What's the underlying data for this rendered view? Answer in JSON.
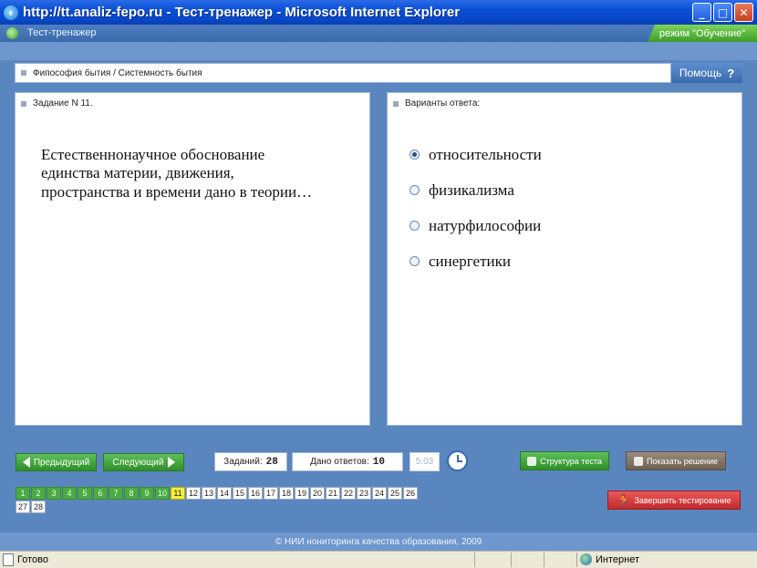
{
  "window": {
    "title": "http://tt.analiz-fepo.ru - Тест-тренажер - Microsoft Internet Explorer",
    "minimize_glyph": "_",
    "maximize_glyph": "□",
    "close_glyph": "✕"
  },
  "app": {
    "title": "Тест-тренажер",
    "mode": "режим \"Обучение\""
  },
  "breadcrumb": "Фипософия бытия / Системность бытия",
  "help": {
    "label": "Помощь",
    "glyph": "?"
  },
  "task": {
    "header": "Задание N 11.",
    "question": "Естественнонаучное обоснование единства материи, движения, пространства и времени дано в теории…"
  },
  "answers": {
    "header": "Варианты ответа:",
    "options": [
      {
        "label": "относительности",
        "checked": true
      },
      {
        "label": "физикализма",
        "checked": false
      },
      {
        "label": "натурфилософии",
        "checked": false
      },
      {
        "label": "синергетики",
        "checked": false
      }
    ]
  },
  "toolbar": {
    "prev": "Предыдущий",
    "next": "Следующий",
    "tasks_label": "Заданий:",
    "tasks_value": "28",
    "answers_label": "Дано ответов:",
    "answers_value": "10",
    "timer": "5:03",
    "structure": "Структура теста",
    "show_solution": "Показать решение",
    "finish": "Завершить тестирование"
  },
  "grid": {
    "cells": [
      "1",
      "2",
      "3",
      "4",
      "5",
      "6",
      "7",
      "8",
      "9",
      "10",
      "11",
      "12",
      "13",
      "14",
      "15",
      "16",
      "17",
      "18",
      "19",
      "20",
      "21",
      "22",
      "23",
      "24",
      "25",
      "26",
      "27",
      "28"
    ],
    "done_count": 10,
    "current": "11"
  },
  "footer": "© НИИ нониторинга качества образования, 2009",
  "status": {
    "left": "Готово",
    "zone": "Интернет"
  },
  "colors": {
    "done": "#4caa44",
    "current": "#f4ee3a",
    "finish": "#d43a3c",
    "accent": "#3a6aae"
  }
}
